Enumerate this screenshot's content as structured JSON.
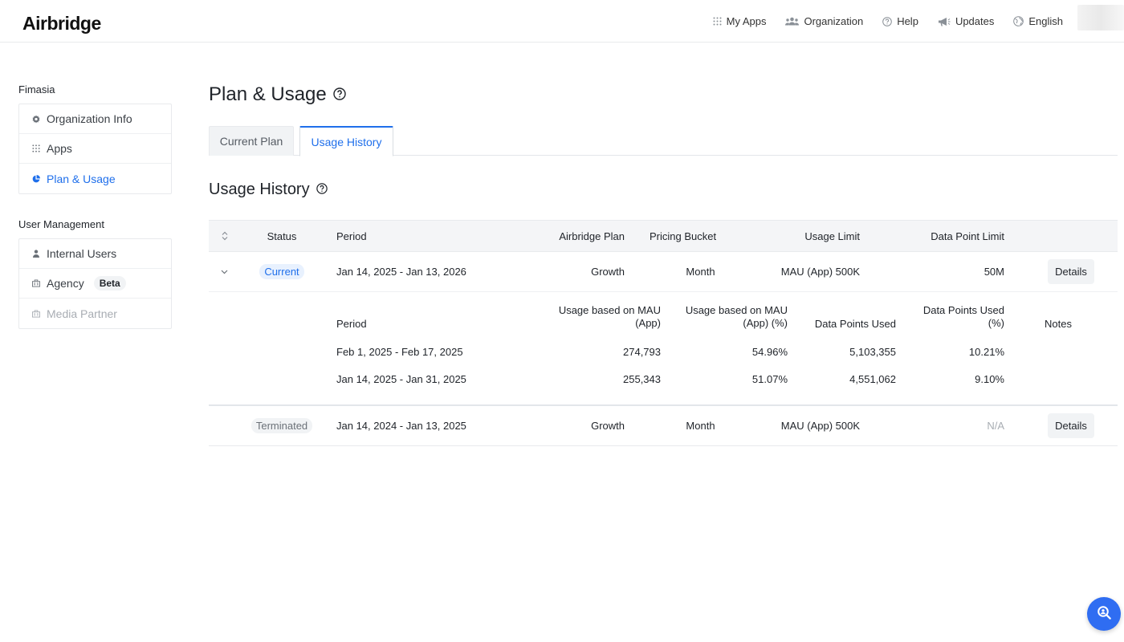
{
  "header": {
    "logo": "Airbridge",
    "nav": [
      {
        "label": "My Apps",
        "icon": "grid-icon"
      },
      {
        "label": "Organization",
        "icon": "people-icon"
      },
      {
        "label": "Help",
        "icon": "question-circle-icon"
      },
      {
        "label": "Updates",
        "icon": "megaphone-icon"
      },
      {
        "label": "English",
        "icon": "globe-icon"
      }
    ]
  },
  "sidebar": {
    "org_title": "Fimasia",
    "org_items": [
      {
        "label": "Organization Info",
        "icon": "gear-icon"
      },
      {
        "label": "Apps",
        "icon": "grid-icon"
      },
      {
        "label": "Plan & Usage",
        "icon": "pie-chart-icon",
        "active": true
      }
    ],
    "user_title": "User Management",
    "user_items": [
      {
        "label": "Internal Users",
        "icon": "user-icon"
      },
      {
        "label": "Agency",
        "icon": "building-icon",
        "badge": "Beta"
      },
      {
        "label": "Media Partner",
        "icon": "building-icon",
        "disabled": true
      }
    ]
  },
  "main": {
    "title": "Plan & Usage",
    "tabs": [
      {
        "label": "Current Plan",
        "active": false
      },
      {
        "label": "Usage History",
        "active": true
      }
    ],
    "section_title": "Usage History"
  },
  "table": {
    "columns": [
      "Status",
      "Period",
      "Airbridge Plan",
      "Pricing Bucket",
      "Usage Limit",
      "Data Point Limit"
    ],
    "rows": [
      {
        "status": "Current",
        "period": "Jan 14, 2025 - Jan 13, 2026",
        "plan": "Growth",
        "bucket": "Month",
        "usage_limit": "MAU (App) 500K",
        "data_point_limit": "50M",
        "action": "Details",
        "expanded": true
      },
      {
        "status": "Terminated",
        "period": "Jan 14, 2024 - Jan 13, 2025",
        "plan": "Growth",
        "bucket": "Month",
        "usage_limit": "MAU (App) 500K",
        "data_point_limit": "N/A",
        "action": "Details",
        "expanded": false
      }
    ],
    "sub_columns": {
      "period": "Period",
      "mau_line1": "Usage based on MAU",
      "mau_line2": "(App)",
      "mau_pct_line1": "Usage based on MAU",
      "mau_pct_line2": "(App) (%)",
      "dp_used": "Data Points Used",
      "dp_pct_line1": "Data Points Used",
      "dp_pct_line2": "(%)",
      "notes": "Notes"
    },
    "sub_rows": [
      {
        "period": "Feb 1, 2025 - Feb 17, 2025",
        "mau": "274,793",
        "mau_pct": "54.96%",
        "dp_used": "5,103,355",
        "dp_pct": "10.21%",
        "notes": ""
      },
      {
        "period": "Jan 14, 2025 - Jan 31, 2025",
        "mau": "255,343",
        "mau_pct": "51.07%",
        "dp_used": "4,551,062",
        "dp_pct": "9.10%",
        "notes": ""
      }
    ]
  },
  "colors": {
    "accent": "#1f6feb",
    "fab": "#2f6df2"
  }
}
